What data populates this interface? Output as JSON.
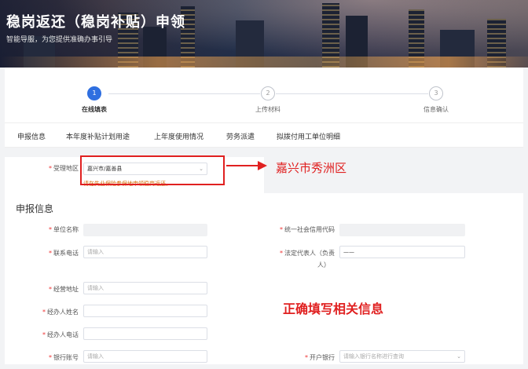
{
  "header": {
    "title": "稳岗返还（稳岗补贴）申领",
    "subtitle": "智能导服，为您提供准确办事引导"
  },
  "steps": [
    {
      "number": "1",
      "label": "在线填表",
      "active": true
    },
    {
      "number": "2",
      "label": "上传材料",
      "active": false
    },
    {
      "number": "3",
      "label": "信息确认",
      "active": false
    }
  ],
  "tabs": [
    "申报信息",
    "本年度补贴计划用途",
    "上年度使用情况",
    "劳务派遣",
    "拟拨付用工单位明细"
  ],
  "region": {
    "label": "受理地区",
    "value": "嘉兴市/嘉善县",
    "hint": "请在失业保险参保地申领稳岗返还。"
  },
  "section_title": "申报信息",
  "fields": {
    "unit_name": {
      "label": "单位名称",
      "placeholder": ""
    },
    "credit_code": {
      "label": "统一社会信用代码",
      "placeholder": ""
    },
    "phone": {
      "label": "联系电话",
      "placeholder": "请输入"
    },
    "legal_rep": {
      "label_line1": "法定代表人（负责",
      "label_line2": "人）",
      "value": "——"
    },
    "address": {
      "label": "经营地址",
      "placeholder": "请输入"
    },
    "handler_name": {
      "label": "经办人姓名",
      "placeholder": ""
    },
    "handler_phone": {
      "label": "经办人电话",
      "placeholder": ""
    },
    "bank_account": {
      "label": "银行账号",
      "placeholder": "请输入"
    },
    "bank": {
      "label": "开户银行",
      "placeholder": "请输入银行名称进行查询"
    }
  },
  "annotations": {
    "region_note": "嘉兴市秀洲区",
    "fill_note": "正确填写相关信息"
  },
  "colors": {
    "primary": "#2f6fe0",
    "annotation": "#e02020",
    "required": "#ee3333"
  }
}
